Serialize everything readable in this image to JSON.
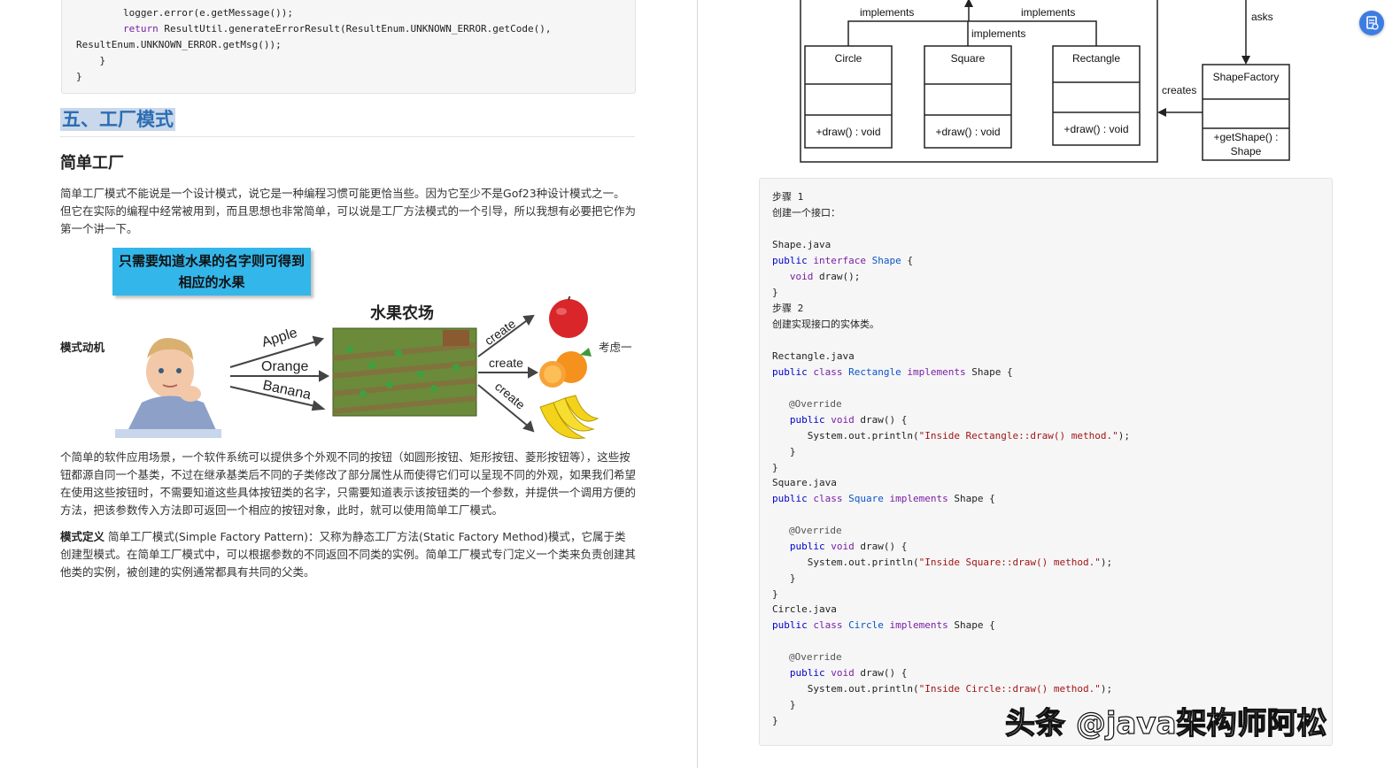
{
  "left": {
    "code_top": [
      "        logger.error(e.getMessage());",
      "        return ResultUtil.generateErrorResult(ResultEnum.UNKNOWN_ERROR.getCode(),",
      "ResultEnum.UNKNOWN_ERROR.getMsg());",
      "    }",
      "}"
    ],
    "section_title": "五、工厂模式",
    "subsection_title": "简单工厂",
    "intro_paragraph": "简单工厂模式不能说是一个设计模式，说它是一种编程习惯可能更恰当些。因为它至少不是Gof23种设计模式之一。但它在实际的编程中经常被用到，而且思想也非常简单，可以说是工厂方法模式的一个引导，所以我想有必要把它作为第一个讲一下。",
    "figure": {
      "callout": "只需要知道水果的名字则可得到相应的水果",
      "farm_title": "水果农场",
      "inputs": [
        "Apple",
        "Orange",
        "Banana"
      ],
      "outputs": [
        "create",
        "create",
        "create"
      ]
    },
    "motive_label": "模式动机",
    "consider_text": "考虑一",
    "motive_paragraph": "个简单的软件应用场景，一个软件系统可以提供多个外观不同的按钮（如圆形按钮、矩形按钮、菱形按钮等），这些按钮都源自同一个基类，不过在继承基类后不同的子类修改了部分属性从而使得它们可以呈现不同的外观，如果我们希望在使用这些按钮时，不需要知道这些具体按钮类的名字，只需要知道表示该按钮类的一个参数，并提供一个调用方便的方法，把该参数传入方法即可返回一个相应的按钮对象，此时，就可以使用简单工厂模式。",
    "definition_label": "模式定义",
    "definition_text": " 简单工厂模式(Simple Factory Pattern)：又称为静态工厂方法(Static Factory Method)模式，它属于类创建型模式。在简单工厂模式中，可以根据参数的不同返回不同类的实例。简单工厂模式专门定义一个类来负责创建其他类的实例，被创建的实例通常都具有共同的父类。"
  },
  "right": {
    "uml": {
      "implements_labels": [
        "implements",
        "implements",
        "implements"
      ],
      "classes": [
        {
          "name": "Circle",
          "method": "+draw() : void"
        },
        {
          "name": "Square",
          "method": "+draw() : void"
        },
        {
          "name": "Rectangle",
          "method": "+draw() : void"
        }
      ],
      "factory": {
        "name": "ShapeFactory",
        "method_line1": "+getShape() :",
        "method_line2": "Shape"
      },
      "asks": "asks",
      "creates": "creates"
    },
    "code": {
      "step1": "步骤 1",
      "step1_desc": "创建一个接口：",
      "file_shape": "Shape.java",
      "step2": "步骤 2",
      "step2_desc": "创建实现接口的实体类。",
      "file_rect": "Rectangle.java",
      "file_square": "Square.java",
      "file_circle": "Circle.java",
      "override": "@Override",
      "str_rect": "\"Inside Rectangle::draw() method.\"",
      "str_square": "\"Inside Square::draw() method.\"",
      "str_circle": "\"Inside Circle::draw() method.\""
    }
  },
  "watermark": "头条 @java架构师阿松"
}
